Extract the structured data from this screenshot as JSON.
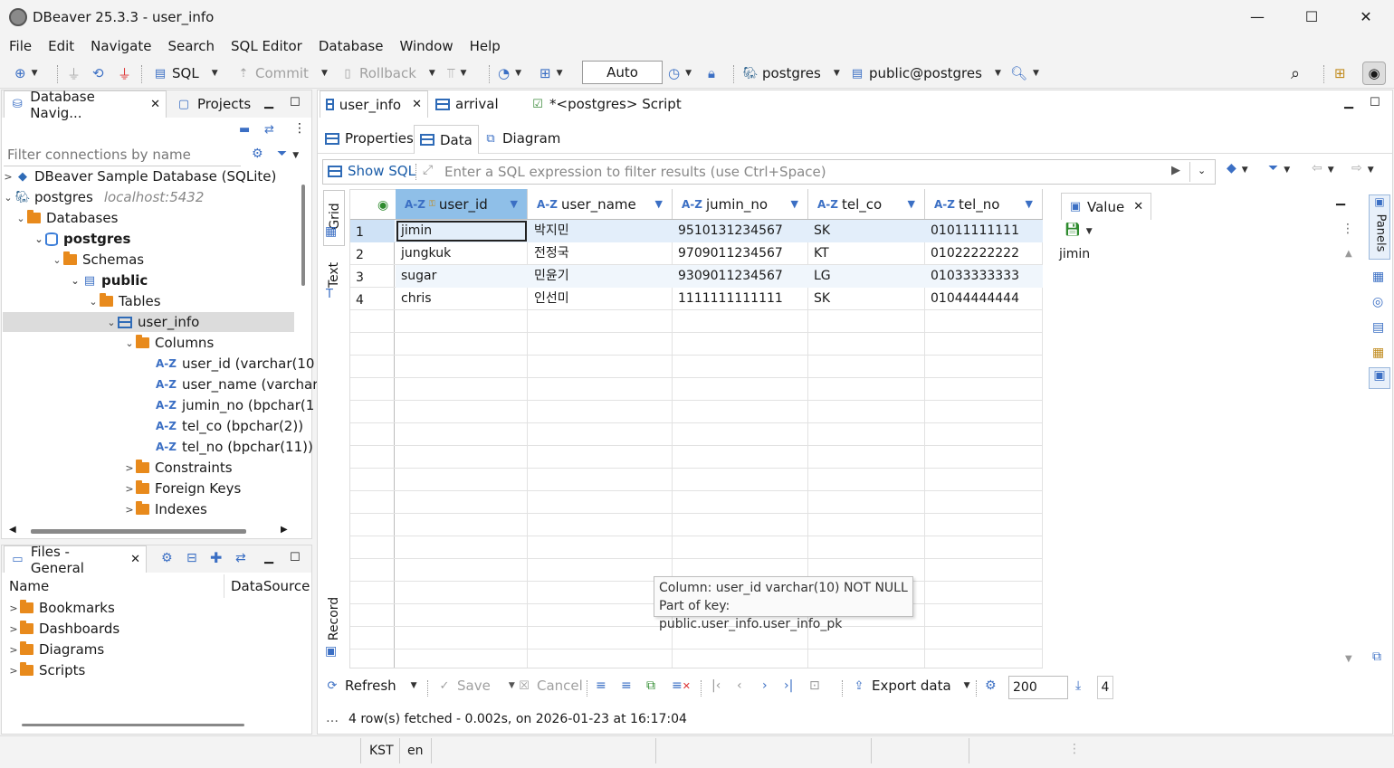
{
  "window": {
    "title": "DBeaver 25.3.3 - user_info",
    "minimize": "—",
    "maximize": "☐",
    "close": "✕"
  },
  "menu": [
    "File",
    "Edit",
    "Navigate",
    "Search",
    "SQL Editor",
    "Database",
    "Window",
    "Help"
  ],
  "toolbar": {
    "sql_label": "SQL",
    "commit_label": "Commit",
    "rollback_label": "Rollback",
    "tx_mode": "Auto",
    "connection": "postgres",
    "schema": "public@postgres"
  },
  "navigator": {
    "tab_label": "Database Navig...",
    "projects_label": "Projects",
    "filter_placeholder": "Filter connections by name",
    "tree": [
      {
        "label": "DBeaver Sample Database (SQLite)"
      },
      {
        "label": "postgres",
        "hint": "localhost:5432"
      },
      {
        "label": "Databases"
      },
      {
        "label": "postgres"
      },
      {
        "label": "Schemas"
      },
      {
        "label": "public"
      },
      {
        "label": "Tables"
      },
      {
        "label": "user_info"
      },
      {
        "label": "Columns"
      },
      {
        "label": "user_id (varchar(10"
      },
      {
        "label": "user_name (varchar"
      },
      {
        "label": "jumin_no (bpchar(1"
      },
      {
        "label": "tel_co (bpchar(2))"
      },
      {
        "label": "tel_no (bpchar(11))"
      },
      {
        "label": "Constraints"
      },
      {
        "label": "Foreign Keys"
      },
      {
        "label": "Indexes"
      }
    ]
  },
  "files": {
    "tab_label": "Files - General",
    "col_name": "Name",
    "col_datasource": "DataSource",
    "items": [
      "Bookmarks",
      "Dashboards",
      "Diagrams",
      "Scripts"
    ]
  },
  "editor": {
    "tabs": [
      "user_info",
      "arrival",
      "*<postgres> Script"
    ],
    "subtabs": [
      "Properties",
      "Data",
      "Diagram"
    ],
    "show_sql": "Show SQL",
    "filter_placeholder": "Enter a SQL expression to filter results (use Ctrl+Space)",
    "side_tabs": {
      "grid": "Grid",
      "text": "Text",
      "record": "Record"
    }
  },
  "grid": {
    "columns": [
      "user_id",
      "user_name",
      "jumin_no",
      "tel_co",
      "tel_no"
    ],
    "rows": [
      {
        "num": "1",
        "cells": [
          "jimin",
          "박지민",
          "9510131234567",
          "SK",
          "01011111111"
        ]
      },
      {
        "num": "2",
        "cells": [
          "jungkuk",
          "전정국",
          "9709011234567",
          "KT",
          "01022222222"
        ]
      },
      {
        "num": "3",
        "cells": [
          "sugar",
          "민윤기",
          "9309011234567",
          "LG",
          "01033333333"
        ]
      },
      {
        "num": "4",
        "cells": [
          "chris",
          "인선미",
          "1111111111111",
          "SK",
          "01044444444"
        ]
      }
    ],
    "tooltip_line1": "Column: user_id varchar(10) NOT NULL",
    "tooltip_line2": "Part of key: public.user_info.user_info_pk"
  },
  "value_panel": {
    "tab_label": "Value",
    "value": "jimin",
    "panels_label": "Panels"
  },
  "bottom_bar": {
    "refresh": "Refresh",
    "save": "Save",
    "cancel": "Cancel",
    "export": "Export data",
    "fetch_size": "200",
    "row_count": "4",
    "status": "4 row(s) fetched - 0.002s, on 2026-01-23 at 16:17:04"
  },
  "statusbar": {
    "timezone": "KST",
    "locale": "en"
  },
  "colors": {
    "accent": "#3b6fc4",
    "selected_header": "#8fbfe8",
    "row_selected": "#e3eefa",
    "folder": "#e88a1c"
  }
}
